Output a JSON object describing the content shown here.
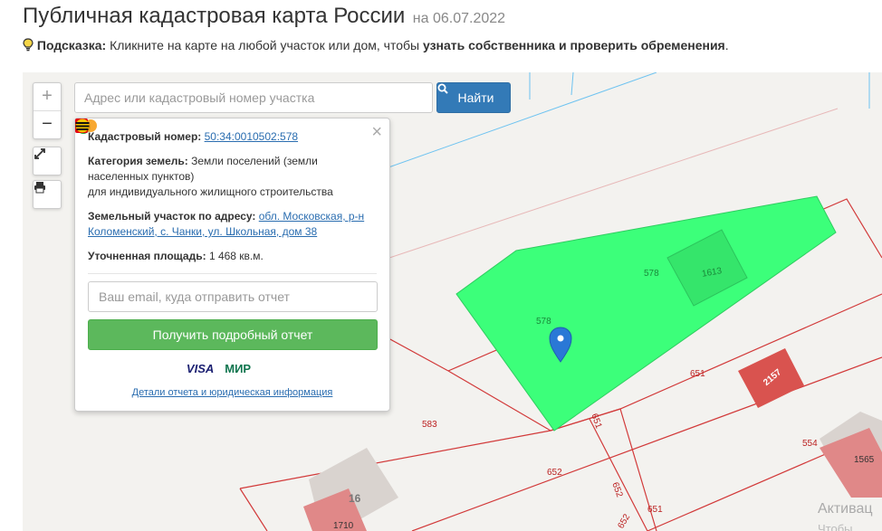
{
  "header": {
    "title": "Публичная кадастровая карта России",
    "date": "на 06.07.2022"
  },
  "hint": {
    "label": "Подсказка:",
    "text": "Кликните на карте на любой участок или дом, чтобы",
    "bold_text": "узнать собственника и проверить обременения",
    "end": "."
  },
  "search": {
    "placeholder": "Адрес или кадастровый номер участка",
    "button": "Найти"
  },
  "zoom": {
    "plus": "+",
    "minus": "−"
  },
  "popup": {
    "cadastral_label": "Кадастровый номер:",
    "cadastral_value": "50:34:0010502:578",
    "category_label": "Категория земель:",
    "category_value": "Земли поселений (земли населенных пунктов)",
    "category_value2": "для индивидуального жилищного строительства",
    "address_label": "Земельный участок по адресу:",
    "address_value": "обл. Московская, р-н Коломенский, с. Чанки, ул. Школьная, дом 38",
    "area_label": "Уточненная площадь:",
    "area_value": "1 468 кв.м.",
    "email_placeholder": "Ваш email, куда отправить отчет",
    "report_button": "Получить подробный отчет",
    "details_link": "Детали отчета и юридическая информация",
    "close": "×"
  },
  "payments": [
    {
      "name": "sberbank-icon",
      "text": "",
      "color": "#21a038"
    },
    {
      "name": "visa-icon",
      "text": "VISA",
      "color": "#1a1f71"
    },
    {
      "name": "mastercard-icon",
      "text": "",
      "color": "#eb001b"
    },
    {
      "name": "mir-icon",
      "text": "МИР",
      "color": "#0f754e"
    },
    {
      "name": "yandex-money-icon",
      "text": "",
      "color": "#f9a21b"
    },
    {
      "name": "webmoney-icon",
      "text": "",
      "color": "#036cb5"
    },
    {
      "name": "qiwi-icon",
      "text": "",
      "color": "#ff8c00"
    },
    {
      "name": "euroset-icon",
      "text": "",
      "color": "#2fa84f"
    },
    {
      "name": "mts-icon",
      "text": "",
      "color": "#e30611"
    },
    {
      "name": "beeline-icon",
      "text": "",
      "color": "#f5c400"
    }
  ],
  "map_labels": {
    "l578a": "578",
    "l578b": "578",
    "l1613": "1613",
    "l651a": "651",
    "l651b": "651",
    "l651c": "651",
    "l2157": "2157",
    "l583": "583",
    "l652a": "652",
    "l652b": "652",
    "l652c": "652",
    "l554": "554",
    "l1565": "1565",
    "l16": "16",
    "l1710": "1710",
    "watermark": "Активац",
    "watermark2": "Чтобы"
  },
  "colors": {
    "parcel_selected": "#3cff7a",
    "building": "#d9534f",
    "boundary": "#d62828",
    "button_primary": "#337ab7",
    "button_success": "#5cb85c"
  }
}
